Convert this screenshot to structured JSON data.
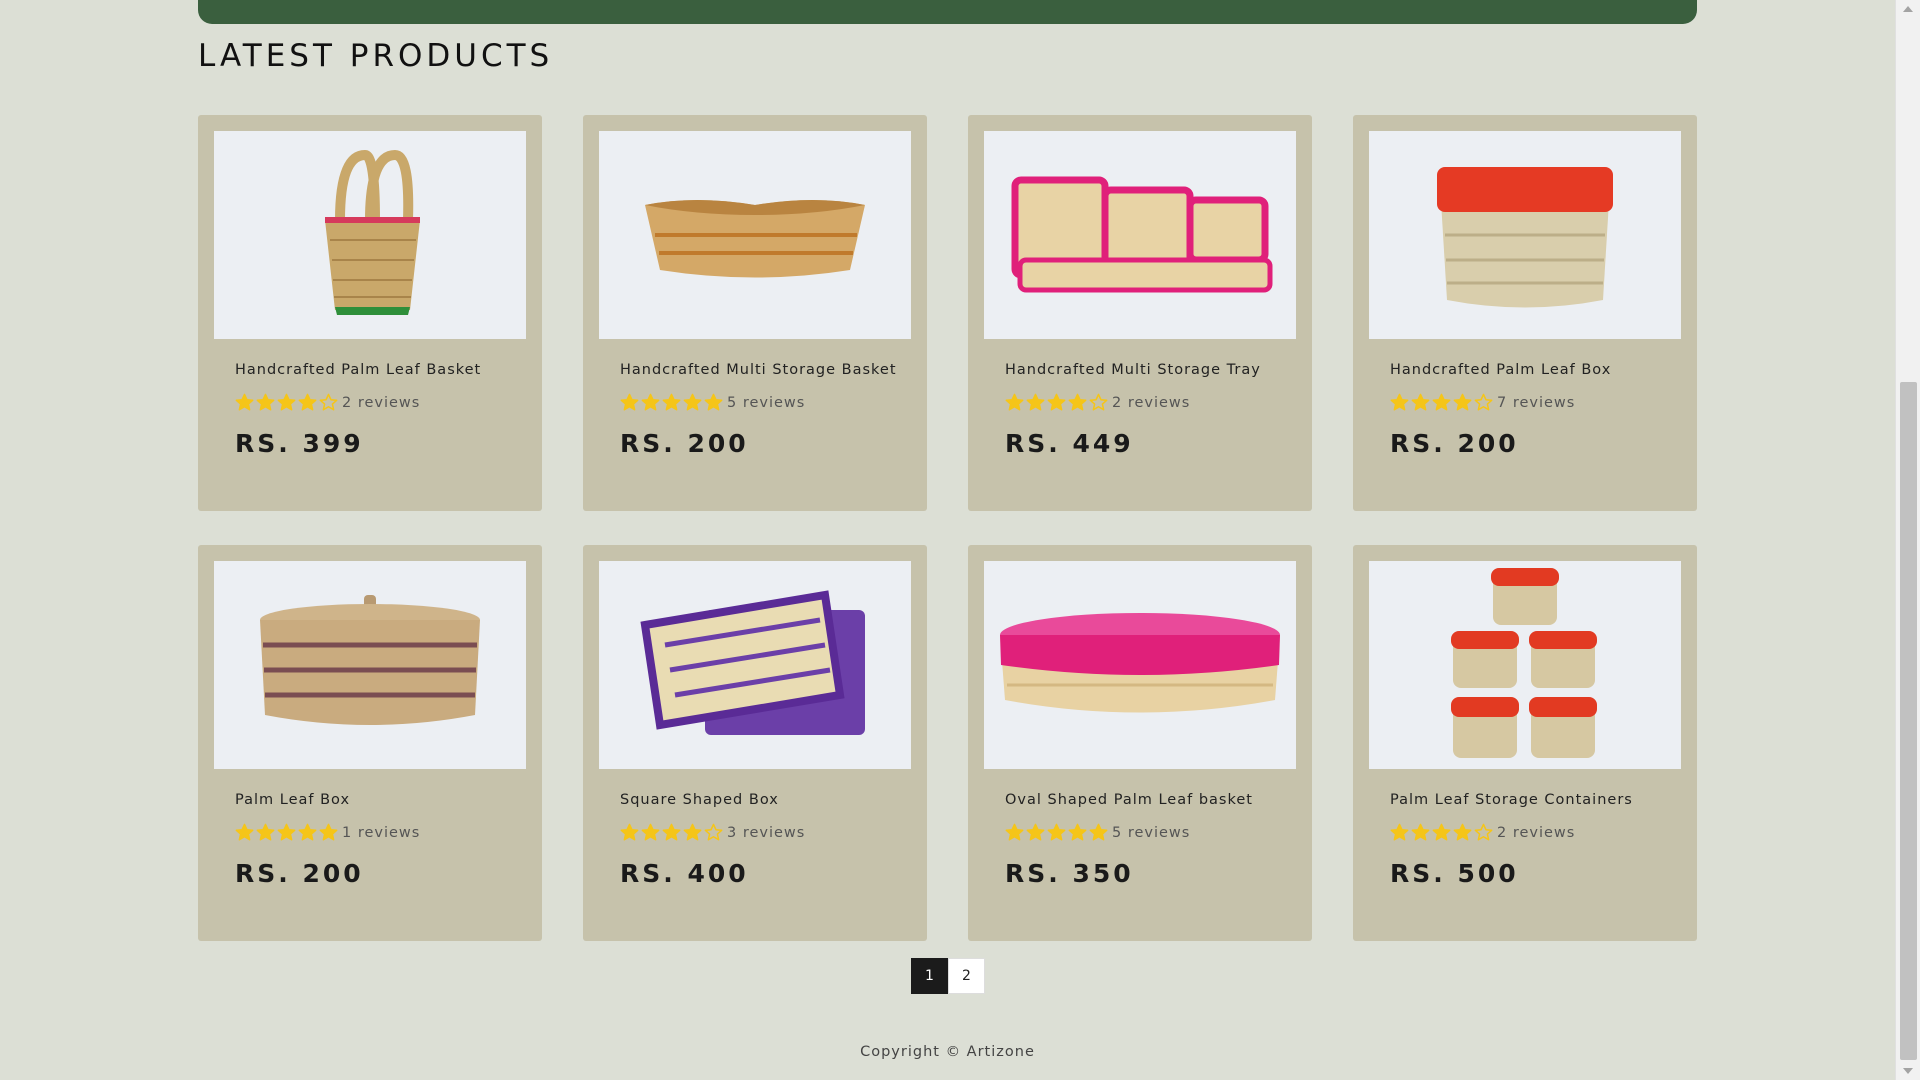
{
  "section_title": "LATEST PRODUCTS",
  "colors": {
    "banner": "#3a5f3e",
    "card": "#c6c2ab",
    "star": "#f5c518",
    "background": "#dcdfd5"
  },
  "products": [
    {
      "name": "Handcrafted Palm Leaf Basket",
      "rating": 4,
      "reviews": "2 reviews",
      "price": "RS. 399",
      "image": "palm-leaf-basket-image"
    },
    {
      "name": "Handcrafted Multi Storage Basket",
      "rating": 5,
      "reviews": "5 reviews",
      "price": "RS. 200",
      "image": "multi-storage-basket-image"
    },
    {
      "name": "Handcrafted Multi Storage Tray",
      "rating": 4,
      "reviews": "2 reviews",
      "price": "RS. 449",
      "image": "multi-storage-tray-image"
    },
    {
      "name": "Handcrafted Palm Leaf Box",
      "rating": 4,
      "reviews": "7 reviews",
      "price": "RS. 200",
      "image": "palm-leaf-box-red-image"
    },
    {
      "name": "Palm Leaf Box",
      "rating": 5,
      "reviews": "1 reviews",
      "price": "RS. 200",
      "image": "palm-leaf-box-brown-image"
    },
    {
      "name": "Square Shaped Box",
      "rating": 4,
      "reviews": "3 reviews",
      "price": "RS. 400",
      "image": "square-box-purple-image"
    },
    {
      "name": "Oval Shaped Palm Leaf basket",
      "rating": 5,
      "reviews": "5 reviews",
      "price": "RS. 350",
      "image": "oval-basket-pink-image"
    },
    {
      "name": "Palm Leaf Storage Containers",
      "rating": 4,
      "reviews": "2 reviews",
      "price": "RS. 500",
      "image": "storage-containers-image"
    }
  ],
  "pagination": {
    "pages": [
      "1",
      "2"
    ],
    "current": "1"
  },
  "footer": {
    "copyright": "Copyright © Artizone"
  }
}
